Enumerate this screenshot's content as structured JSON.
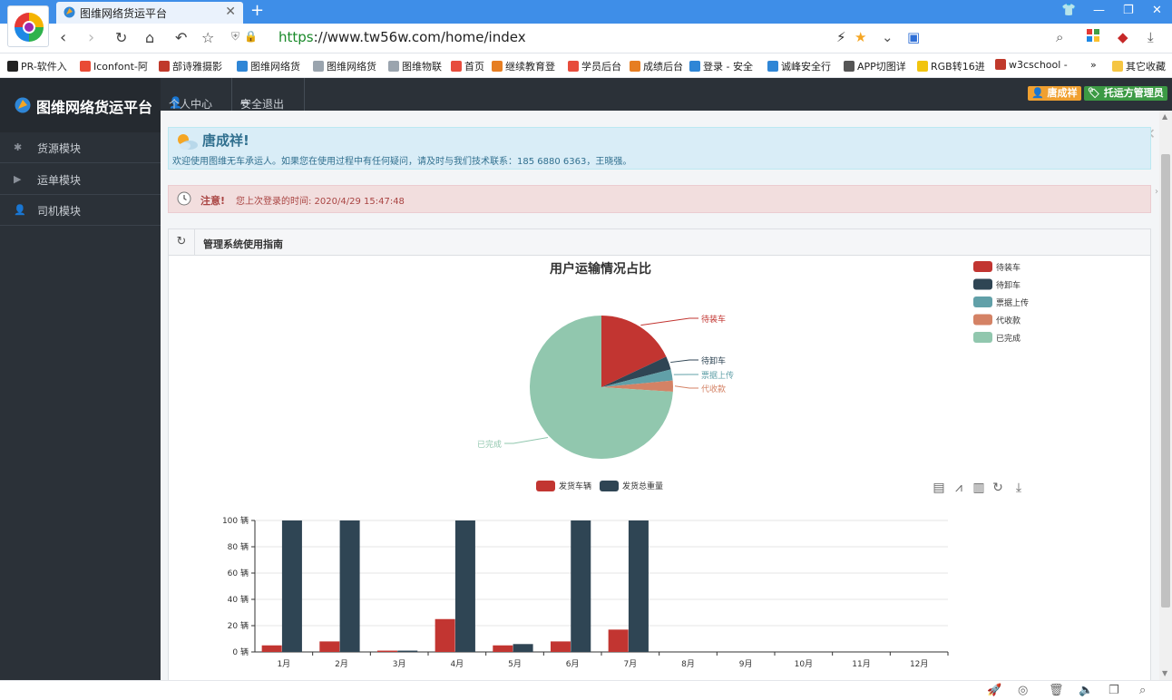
{
  "browser": {
    "tab_title": "图维网络货运平台",
    "url_https": "https",
    "url_rest": "://www.tw56w.com/home/index"
  },
  "bookmarks": [
    {
      "label": "PR-软件入",
      "color": "#222222"
    },
    {
      "label": "Iconfont-阿",
      "color": "#e94b35"
    },
    {
      "label": "部诗雅摄影",
      "color": "#c0392b"
    },
    {
      "label": "图维网络货",
      "color": "#2f86d6"
    },
    {
      "label": "图维网络货",
      "color": "#9aa4ae"
    },
    {
      "label": "图维物联",
      "color": "#9aa4ae"
    },
    {
      "label": "首页",
      "color": "#e74c3c"
    },
    {
      "label": "继续教育登",
      "color": "#e67e22"
    },
    {
      "label": "学员后台",
      "color": "#e74c3c"
    },
    {
      "label": "成绩后台",
      "color": "#e67e22"
    },
    {
      "label": "登录 - 安全",
      "color": "#2f86d6"
    },
    {
      "label": "诚峰安全行",
      "color": "#2f86d6"
    },
    {
      "label": "APP切图详",
      "color": "#555555"
    },
    {
      "label": "RGB转16进",
      "color": "#f1c40f"
    },
    {
      "label": "w3cschool -",
      "color": "#c0392b"
    }
  ],
  "bookmarks_more": "»",
  "bookmarks_other": "其它收藏",
  "app": {
    "brand": "图维网络货运平台",
    "topnav": {
      "profile": "个人中心",
      "logout": "安全退出"
    },
    "user_badge": "唐成祥",
    "role_badge": "托运方管理员",
    "sidebar": [
      {
        "label": "货源模块",
        "icon": "asterisk-icon"
      },
      {
        "label": "运单模块",
        "icon": "play-icon"
      },
      {
        "label": "司机模块",
        "icon": "user-icon"
      }
    ],
    "welcome": {
      "name": "唐成祥!",
      "message": "欢迎使用图维无车承运人。如果您在使用过程中有任何疑问，请及时与我们技术联系：185 6880 6363，王晓强。"
    },
    "notice": {
      "label": "注意!",
      "text": "您上次登录的时间: 2020/4/29 15:47:48"
    },
    "panel_title": "管理系统使用指南",
    "colors": {
      "red": "#c23531",
      "navy": "#2f4554",
      "teal": "#61a0a8",
      "orange": "#d48265",
      "mint": "#91c7ae"
    }
  },
  "chart_data": [
    {
      "type": "pie",
      "title": "用户运输情况占比",
      "legend_position": "top-right",
      "slices": [
        {
          "name": "待装车",
          "value": 18,
          "color": "#c23531"
        },
        {
          "name": "待卸车",
          "value": 3,
          "color": "#2f4554"
        },
        {
          "name": "票据上传",
          "value": 2.5,
          "color": "#61a0a8"
        },
        {
          "name": "代收款",
          "value": 2.5,
          "color": "#d48265"
        },
        {
          "name": "已完成",
          "value": 74,
          "color": "#91c7ae"
        }
      ]
    },
    {
      "type": "bar",
      "legend_position": "top-center",
      "categories": [
        "1月",
        "2月",
        "3月",
        "4月",
        "5月",
        "6月",
        "7月",
        "8月",
        "9月",
        "10月",
        "11月",
        "12月"
      ],
      "series": [
        {
          "name": "发货车辆",
          "color": "#c23531",
          "values": [
            5,
            8,
            1,
            25,
            5,
            8,
            17,
            0,
            0,
            0,
            0,
            0
          ]
        },
        {
          "name": "发货总重量",
          "color": "#2f4554",
          "values": [
            100,
            100,
            1,
            100,
            6,
            100,
            100,
            0,
            0,
            0,
            0,
            0
          ]
        }
      ],
      "ylim": [
        0,
        100
      ],
      "yticks": [
        0,
        20,
        40,
        60,
        80,
        100
      ],
      "y_unit": "辆",
      "grid": true,
      "toolbox": [
        "data-view-icon",
        "line-chart-icon",
        "bar-chart-icon",
        "restore-icon",
        "download-icon"
      ]
    }
  ]
}
